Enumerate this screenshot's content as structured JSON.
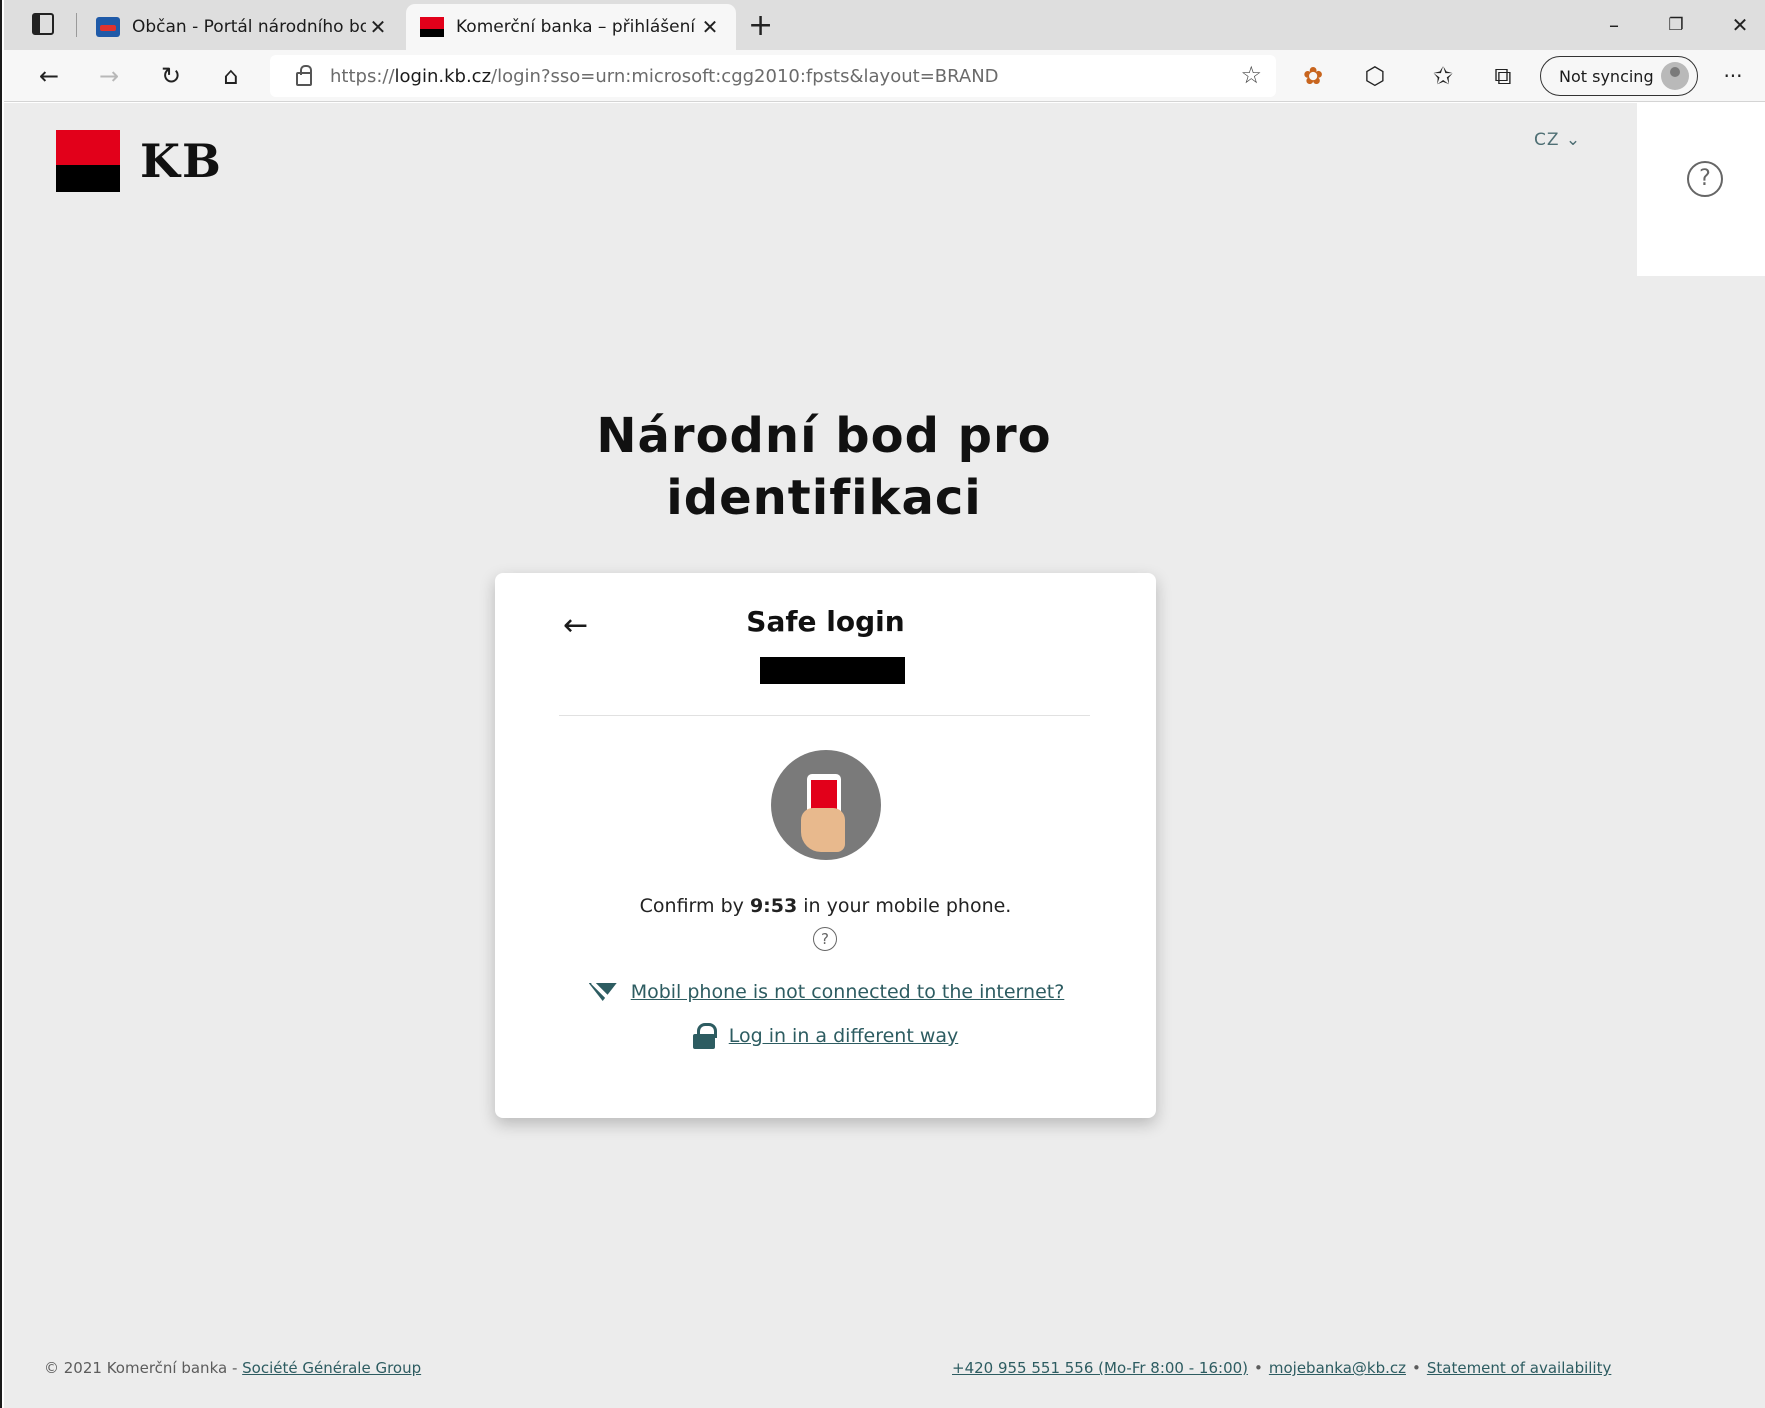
{
  "browser": {
    "tabs": [
      {
        "title": "Občan - Portál národního bodu",
        "active": false
      },
      {
        "title": "Komerční banka – přihlášení",
        "active": true
      }
    ],
    "address": {
      "url_prefix": "https://",
      "url_host": "login.kb.cz",
      "url_path": "/login?sso=urn:microsoft:cgg2010:fpsts&layout=BRAND"
    },
    "sync_label": "Not syncing",
    "more_label": "···"
  },
  "header": {
    "logo_text": "KB",
    "language": "CZ ⌄",
    "help_glyph": "?"
  },
  "hero": {
    "title_line1": "Národní bod pro",
    "title_line2": "identifikaci"
  },
  "card": {
    "title": "Safe login",
    "confirm_before": "Confirm by ",
    "timer": "9:53",
    "confirm_after": " in your mobile phone.",
    "help_glyph": "?",
    "link_offline": "Mobil phone is not connected to the internet?",
    "link_other": "Log in in a different way"
  },
  "footer": {
    "copyright": "© 2021 Komerční banka - ",
    "group_link": "Société Générale Group",
    "phone_link": "+420 955 551 556 (Mo-Fr 8:00 - 16:00)",
    "email_link": "mojebanka@kb.cz",
    "availability_link": "Statement of availability",
    "separator": "•"
  },
  "colors": {
    "brand_red": "#e2001a",
    "link_teal": "#2d5c61",
    "page_bg": "#ececec"
  },
  "icons": [
    "sidebar-toggle-icon",
    "close-icon",
    "plus-icon",
    "back-icon",
    "forward-icon",
    "refresh-icon",
    "home-icon",
    "lock-icon",
    "favorite-add-icon",
    "extension-icon",
    "puzzle-icon",
    "favorites-icon",
    "collections-icon",
    "question-icon",
    "arrow-left-icon",
    "phone-icon",
    "no-wifi-icon",
    "padlock-icon"
  ]
}
